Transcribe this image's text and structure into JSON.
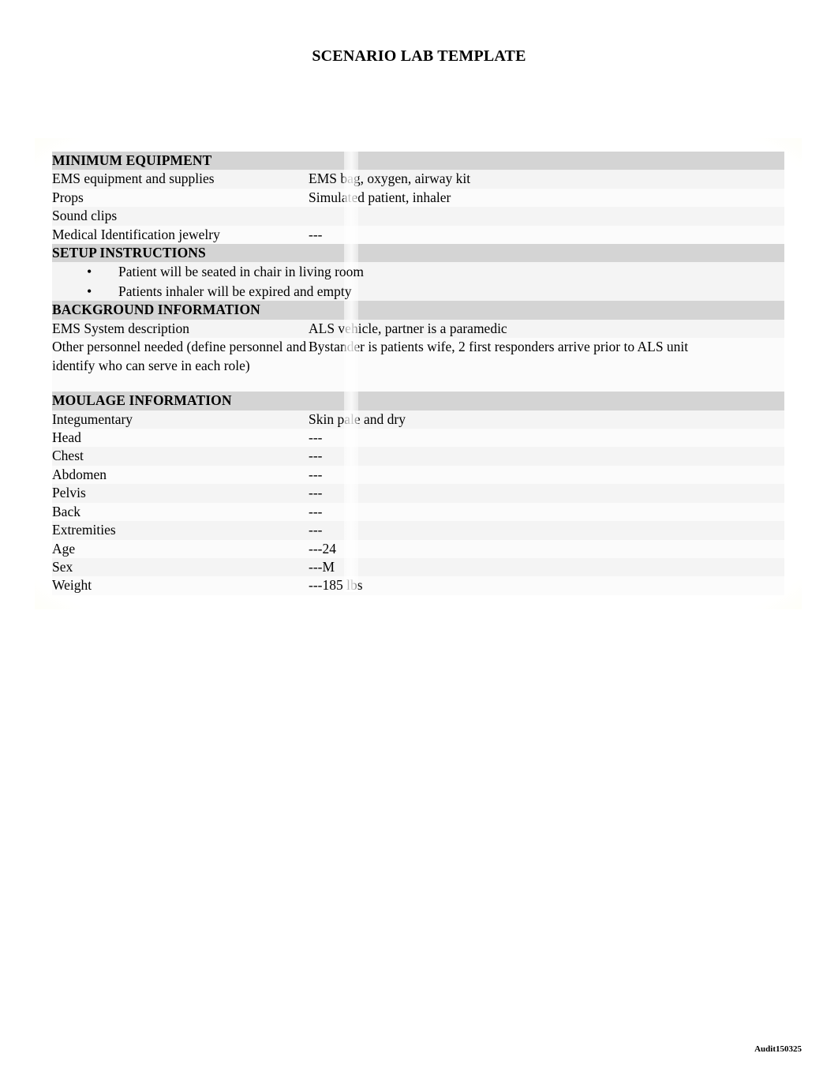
{
  "document": {
    "title": "SCENARIO LAB TEMPLATE",
    "footer_note": "Audit150325",
    "bullet_glyph": "•",
    "colors": {
      "glow": "#f7f6c4",
      "section_row": "#d4d4d4",
      "row_shade_dark": "#eaeaea",
      "row_shade_light": "#f4f4f4",
      "text": "#000000"
    }
  },
  "sections": [
    {
      "id": "minimum-equipment",
      "heading": "MINIMUM EQUIPMENT",
      "rows": [
        {
          "label": "EMS equipment and supplies",
          "value": "EMS bag, oxygen, airway kit"
        },
        {
          "label": "Props",
          "value": "Simulated patient, inhaler"
        },
        {
          "label": "Sound clips",
          "value": ""
        },
        {
          "label": "Medical Identification jewelry",
          "value": "---"
        }
      ]
    },
    {
      "id": "setup-instructions",
      "heading": "SETUP INSTRUCTIONS",
      "bullets": [
        "Patient will be seated in chair in living room",
        "Patients inhaler will be expired and empty"
      ]
    },
    {
      "id": "background-information",
      "heading": "BACKGROUND INFORMATION",
      "rows": [
        {
          "label": "EMS System description",
          "value": "ALS vehicle, partner is a paramedic"
        },
        {
          "label": "Other personnel needed (define personnel and identify who can serve in each role)",
          "value": "Bystander is patients wife, 2 first responders arrive prior to ALS unit"
        }
      ]
    },
    {
      "id": "moulage-information",
      "heading": "MOULAGE INFORMATION",
      "rows": [
        {
          "label": "Integumentary",
          "value": "Skin pale and dry"
        },
        {
          "label": "Head",
          "value": "---"
        },
        {
          "label": "Chest",
          "value": "---"
        },
        {
          "label": "Abdomen",
          "value": "---"
        },
        {
          "label": "Pelvis",
          "value": "---"
        },
        {
          "label": "Back",
          "value": "---"
        },
        {
          "label": "Extremities",
          "value": "---"
        },
        {
          "label": "Age",
          "value": "---24"
        },
        {
          "label": "Sex",
          "value": "---M"
        },
        {
          "label": "Weight",
          "value": "---185 lbs"
        }
      ]
    }
  ]
}
